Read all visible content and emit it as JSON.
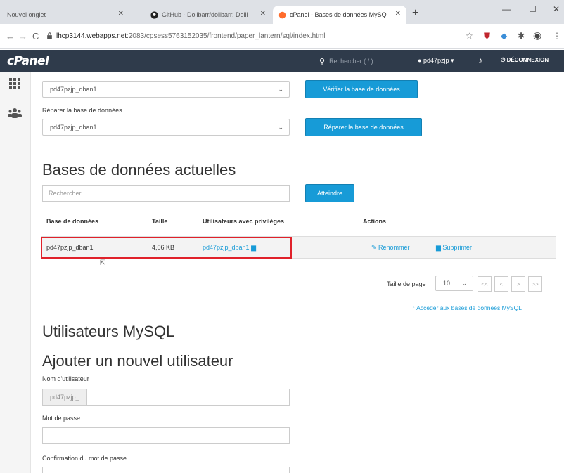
{
  "browser": {
    "tabs": [
      {
        "title": "Nouvel onglet"
      },
      {
        "title": "GitHub - Dolibarr/dolibarr: Dolil"
      },
      {
        "title": "cPanel - Bases de données MySQ"
      }
    ],
    "url_host": "lhcp3144.webapps.net",
    "url_path": ":2083/cpsess5763152035/frontend/paper_lantern/sql/index.html"
  },
  "cpanel": {
    "logo": "cPanel",
    "search_placeholder": "Rechercher ( / )",
    "username": "pd47pzjp",
    "logout_label": "DÉCONNEXION"
  },
  "check": {
    "selected_db": "pd47pzjp_dban1",
    "button_label": "Vérifier la base de données"
  },
  "repair": {
    "label": "Réparer la base de données",
    "selected_db": "pd47pzjp_dban1",
    "button_label": "Réparer la base de données"
  },
  "current_dbs": {
    "heading": "Bases de données actuelles",
    "search_placeholder": "Rechercher",
    "go_button": "Atteindre",
    "columns": {
      "database": "Base de données",
      "size": "Taille",
      "users": "Utilisateurs avec privilèges",
      "actions": "Actions"
    },
    "rows": [
      {
        "name": "pd47pzjp_dban1",
        "size": "4,06 KB",
        "user": "pd47pzjp_dban1",
        "rename": "Renommer",
        "delete": "Supprimer"
      }
    ],
    "page_size_label": "Taille de page",
    "page_size": "10",
    "pager": [
      "<<",
      "<",
      ">",
      ">>"
    ],
    "access_link": "Accéder aux bases de données MySQL"
  },
  "mysql_users": {
    "heading": "Utilisateurs MySQL",
    "add_heading": "Ajouter un nouvel utilisateur",
    "username_label": "Nom d'utilisateur",
    "username_prefix": "pd47pzjp_",
    "password_label": "Mot de passe",
    "confirm_label": "Confirmation du mot de passe"
  },
  "colors": {
    "header_bg": "#2f3b4b",
    "button_blue": "#179bd7",
    "highlight_red": "#e0212a"
  }
}
